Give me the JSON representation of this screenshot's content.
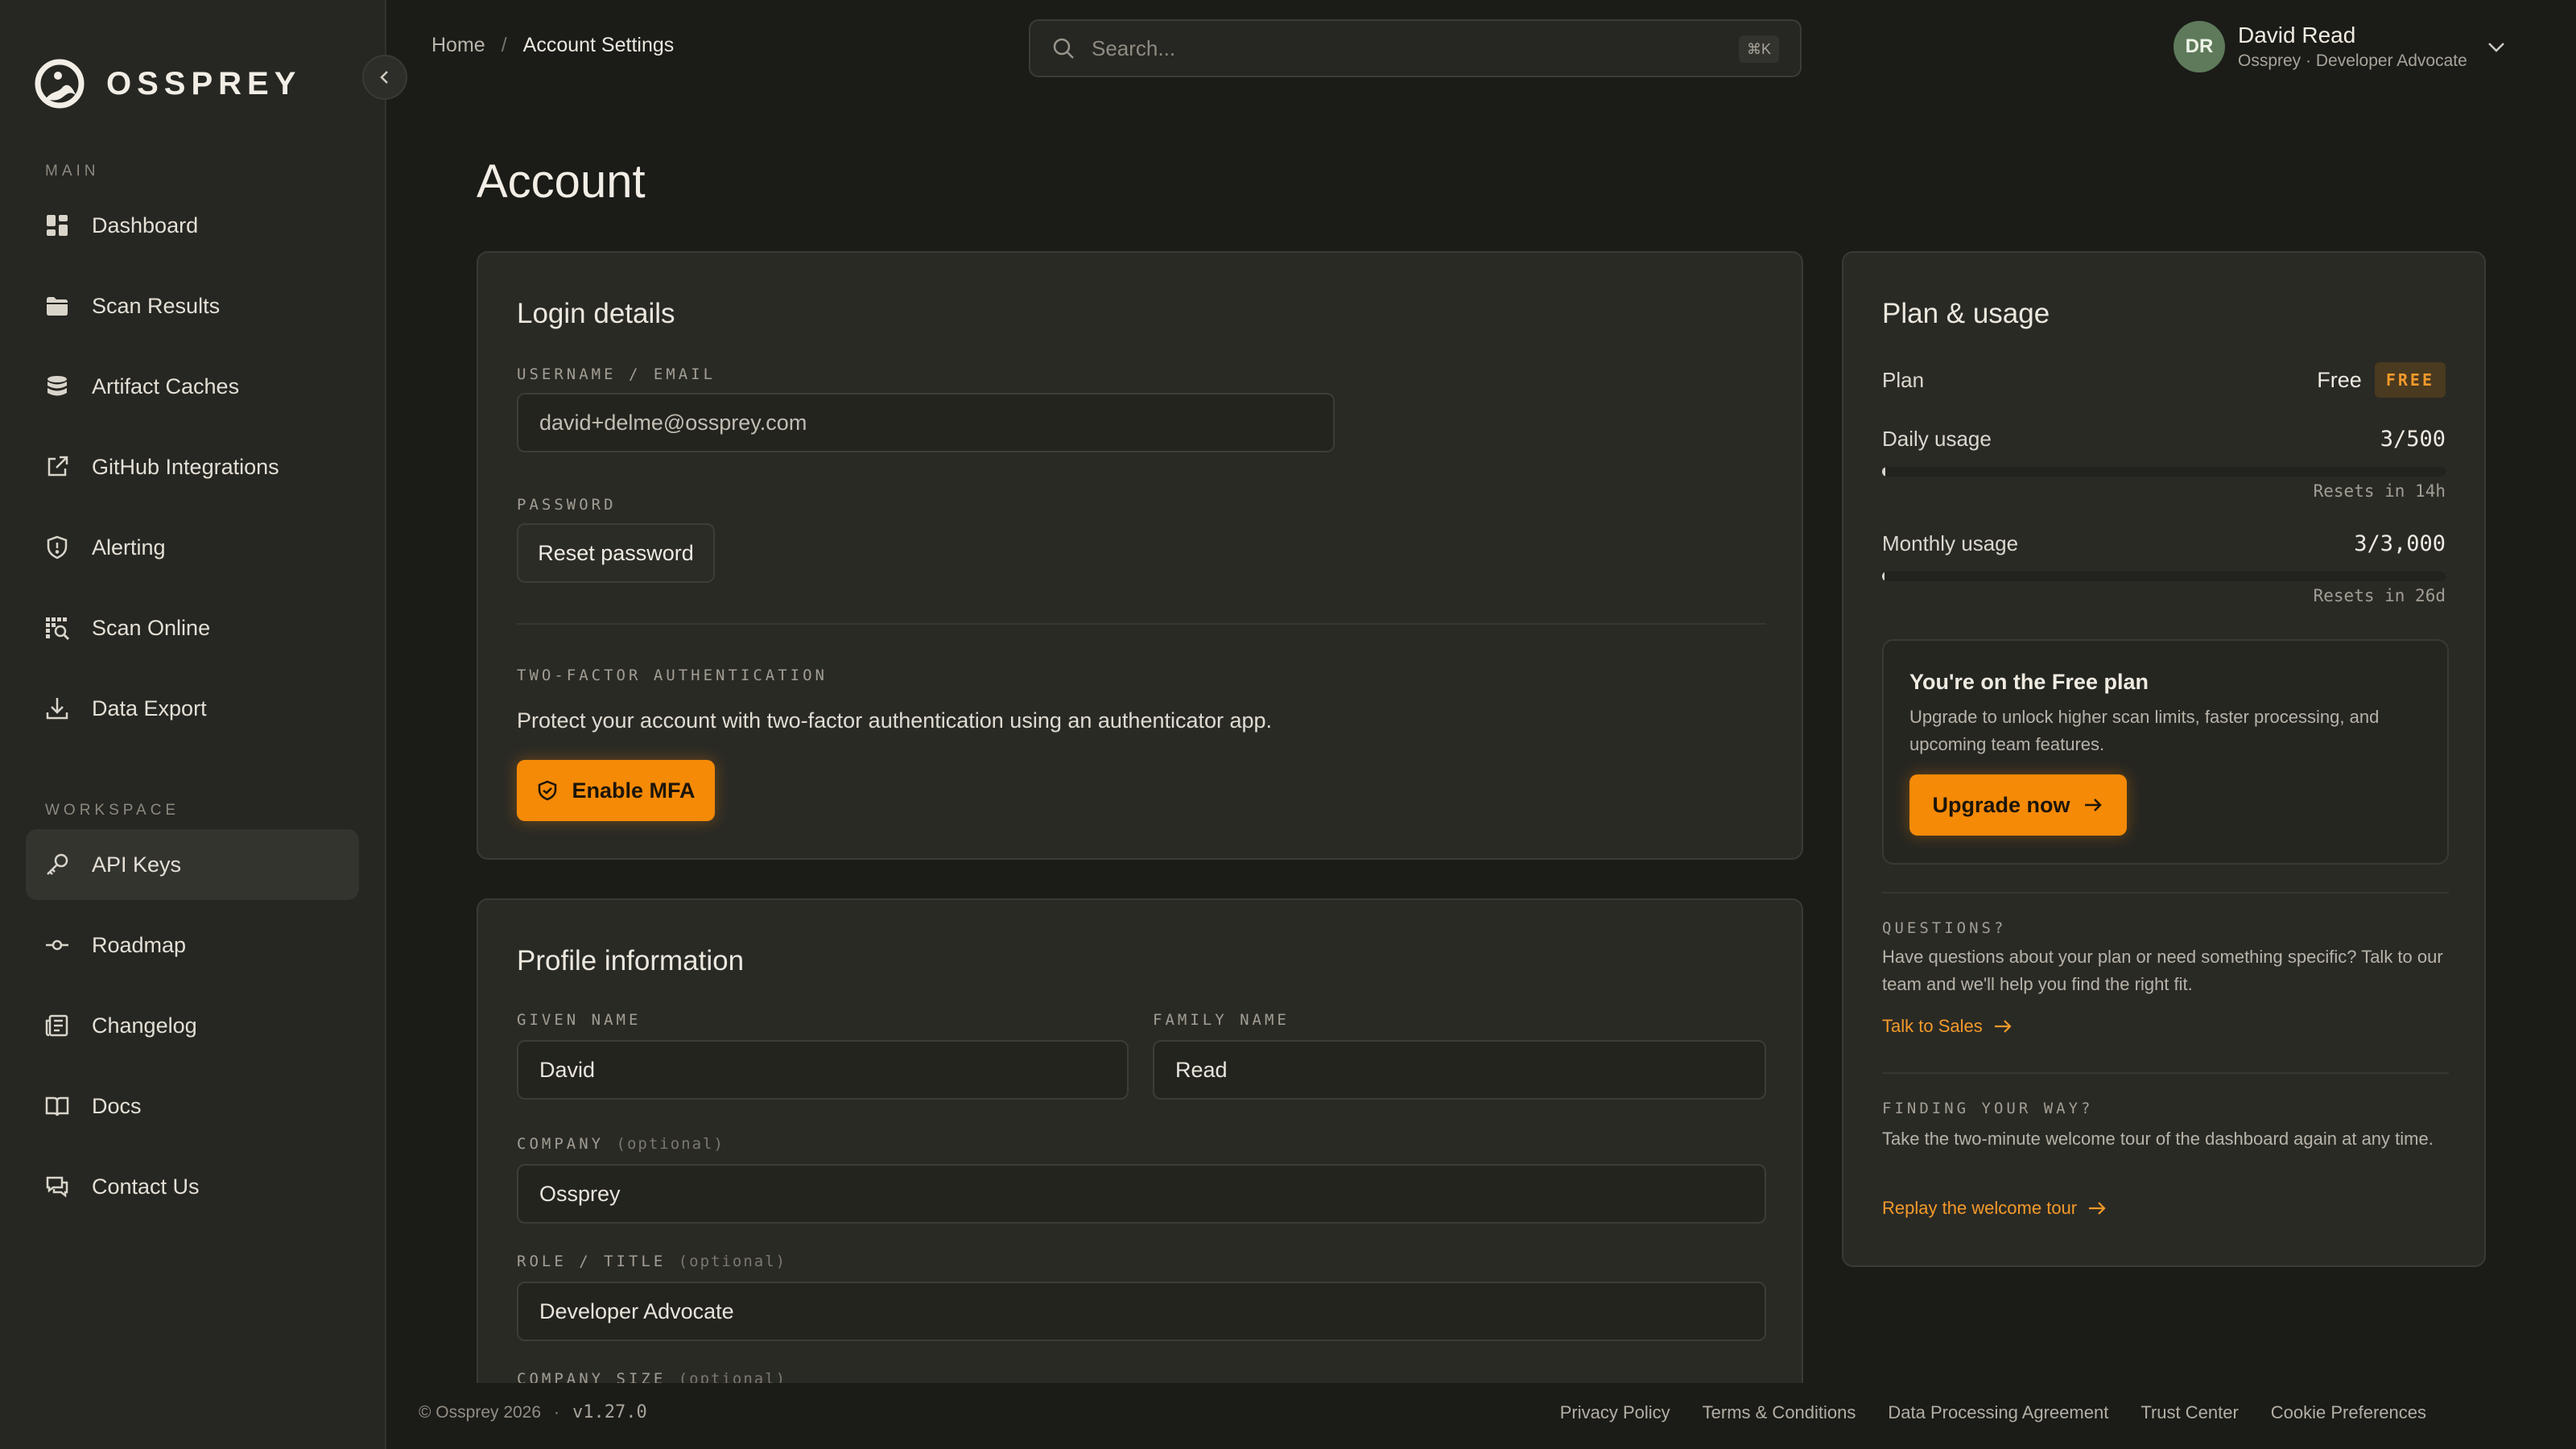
{
  "brand": {
    "name": "OSSPREY"
  },
  "sidebar": {
    "sections": [
      {
        "label": "MAIN",
        "items": [
          {
            "label": "Dashboard",
            "icon": "dashboard-icon"
          },
          {
            "label": "Scan Results",
            "icon": "folder-icon"
          },
          {
            "label": "Artifact Caches",
            "icon": "database-icon"
          },
          {
            "label": "GitHub Integrations",
            "icon": "external-link-icon"
          },
          {
            "label": "Alerting",
            "icon": "shield-alert-icon"
          },
          {
            "label": "Scan Online",
            "icon": "scan-icon"
          },
          {
            "label": "Data Export",
            "icon": "download-icon"
          }
        ]
      },
      {
        "label": "WORKSPACE",
        "items": [
          {
            "label": "API Keys",
            "icon": "key-icon",
            "active": true
          },
          {
            "label": "Roadmap",
            "icon": "commit-icon"
          },
          {
            "label": "Changelog",
            "icon": "newspaper-icon"
          },
          {
            "label": "Docs",
            "icon": "book-icon"
          },
          {
            "label": "Contact Us",
            "icon": "chat-icon"
          }
        ]
      }
    ]
  },
  "breadcrumb": {
    "home": "Home",
    "separator": "/",
    "current": "Account Settings"
  },
  "search": {
    "placeholder": "Search...",
    "shortcut": "⌘K"
  },
  "user": {
    "initials": "DR",
    "name": "David Read",
    "subtitle": "Ossprey · Developer Advocate"
  },
  "page": {
    "title": "Account"
  },
  "login": {
    "title": "Login details",
    "username_label": "USERNAME / EMAIL",
    "username_value": "david+delme@ossprey.com",
    "password_label": "PASSWORD",
    "reset_button": "Reset password",
    "mfa_label": "TWO-FACTOR AUTHENTICATION",
    "mfa_text": "Protect your account with two-factor authentication using an authenticator app.",
    "mfa_button": "Enable MFA"
  },
  "profile": {
    "title": "Profile information",
    "given_label": "GIVEN NAME",
    "given_value": "David",
    "family_label": "FAMILY NAME",
    "family_value": "Read",
    "company_label": "COMPANY",
    "company_opt": "(optional)",
    "company_value": "Ossprey",
    "role_label": "ROLE / TITLE",
    "role_opt": "(optional)",
    "role_value": "Developer Advocate",
    "size_label": "COMPANY SIZE",
    "size_opt": "(optional)"
  },
  "plan": {
    "title": "Plan & usage",
    "plan_label": "Plan",
    "plan_value": "Free",
    "plan_badge": "FREE",
    "daily_label": "Daily usage",
    "daily_value": "3/500",
    "daily_fraction": 0.006,
    "daily_reset": "Resets in 14h",
    "monthly_label": "Monthly usage",
    "monthly_value": "3/3,000",
    "monthly_fraction": 0.001,
    "monthly_reset": "Resets in 26d",
    "upgrade_title": "You're on the Free plan",
    "upgrade_desc": "Upgrade to unlock higher scan limits, faster processing, and upcoming team features.",
    "upgrade_button": "Upgrade now",
    "questions_label": "QUESTIONS?",
    "questions_text": "Have questions about your plan or need something specific? Talk to our team and we'll help you find the right fit.",
    "questions_link": "Talk to Sales",
    "tour_label": "FINDING YOUR WAY?",
    "tour_text": "Take the two-minute welcome tour of the dashboard again at any time.",
    "tour_link": "Replay the welcome tour"
  },
  "footer": {
    "copyright": "© Ossprey 2026",
    "dot": "·",
    "version": "v1.27.0",
    "links": [
      "Privacy Policy",
      "Terms & Conditions",
      "Data Processing Agreement",
      "Trust Center",
      "Cookie Preferences"
    ]
  },
  "colors": {
    "accent": "#f58a07",
    "background": "#1b1b18",
    "sidebar": "#262622",
    "card": "#2a2a25",
    "avatar": "#5e7a5a"
  }
}
